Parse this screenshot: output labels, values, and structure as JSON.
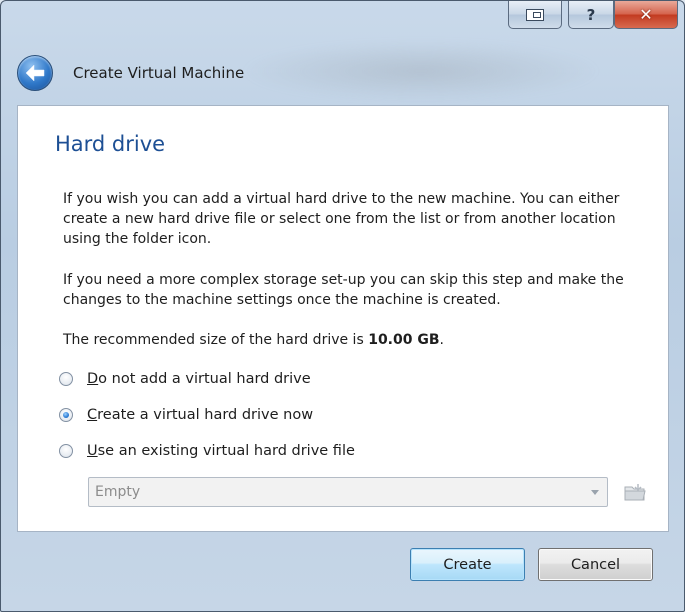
{
  "window": {
    "caption_help": "?",
    "caption_close": "✕"
  },
  "header": {
    "title": "Create Virtual Machine",
    "back_icon": "back-arrow-icon"
  },
  "page": {
    "title": "Hard drive",
    "paragraph1": "If you wish you can add a virtual hard drive to the new machine. You can either create a new hard drive file or select one from the list or from another location using the folder icon.",
    "paragraph2": "If you need a more complex storage set-up you can skip this step and make the changes to the machine settings once the machine is created.",
    "recommended_prefix": "The recommended size of the hard drive is ",
    "recommended_size": "10.00 GB",
    "recommended_suffix": "."
  },
  "options": [
    {
      "accel": "D",
      "rest": "o not add a virtual hard drive",
      "checked": false
    },
    {
      "accel": "C",
      "rest": "reate a virtual hard drive now",
      "checked": true
    },
    {
      "accel": "U",
      "rest": "se an existing virtual hard drive file",
      "checked": false
    }
  ],
  "disk_combo": {
    "value": "Empty",
    "enabled": false
  },
  "buttons": {
    "create": "Create",
    "cancel": "Cancel"
  },
  "colors": {
    "title_blue": "#1d4f94",
    "default_button_border": "#3c7fb1"
  }
}
